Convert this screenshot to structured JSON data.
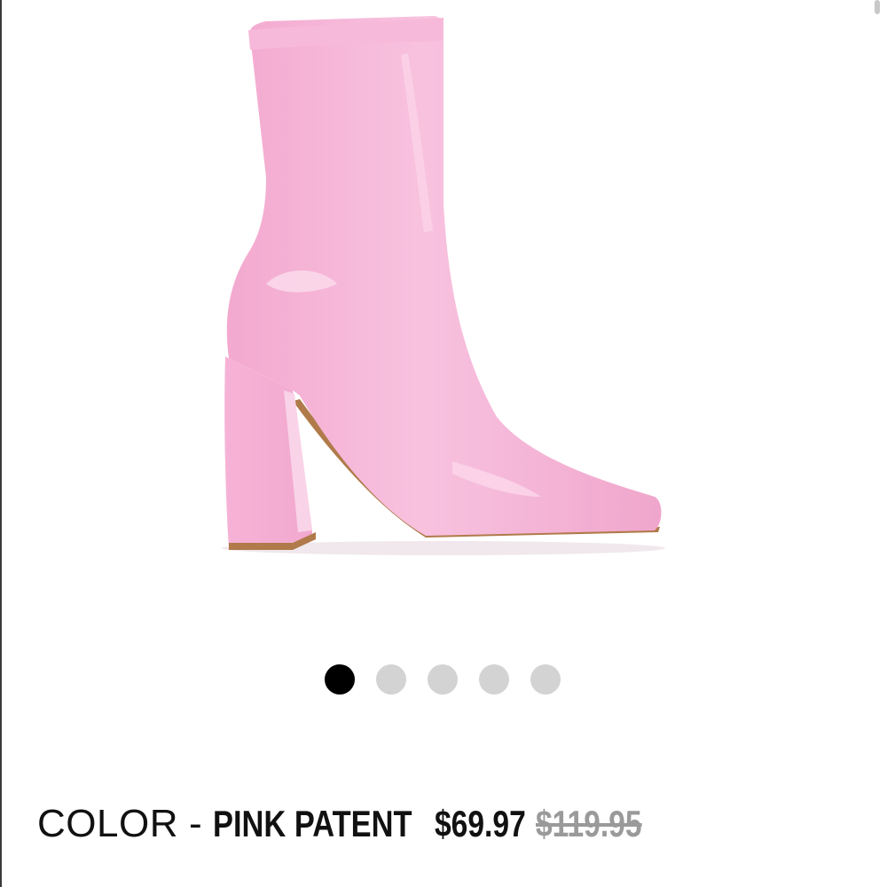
{
  "product": {
    "image_alt": "Pink patent block-heel ankle boot",
    "color_label": "COLOR",
    "color_separator": "-",
    "color_value": "PINK PATENT",
    "sale_price": "$69.97",
    "original_price": "$119.95"
  },
  "gallery": {
    "total_images": 5,
    "active_index": 0
  },
  "colors": {
    "boot": "#f6b8d8",
    "sole": "#b07a4a",
    "dot_active": "#000000",
    "dot_inactive": "#d3d3d3",
    "strike_price": "#9a9a9a"
  }
}
